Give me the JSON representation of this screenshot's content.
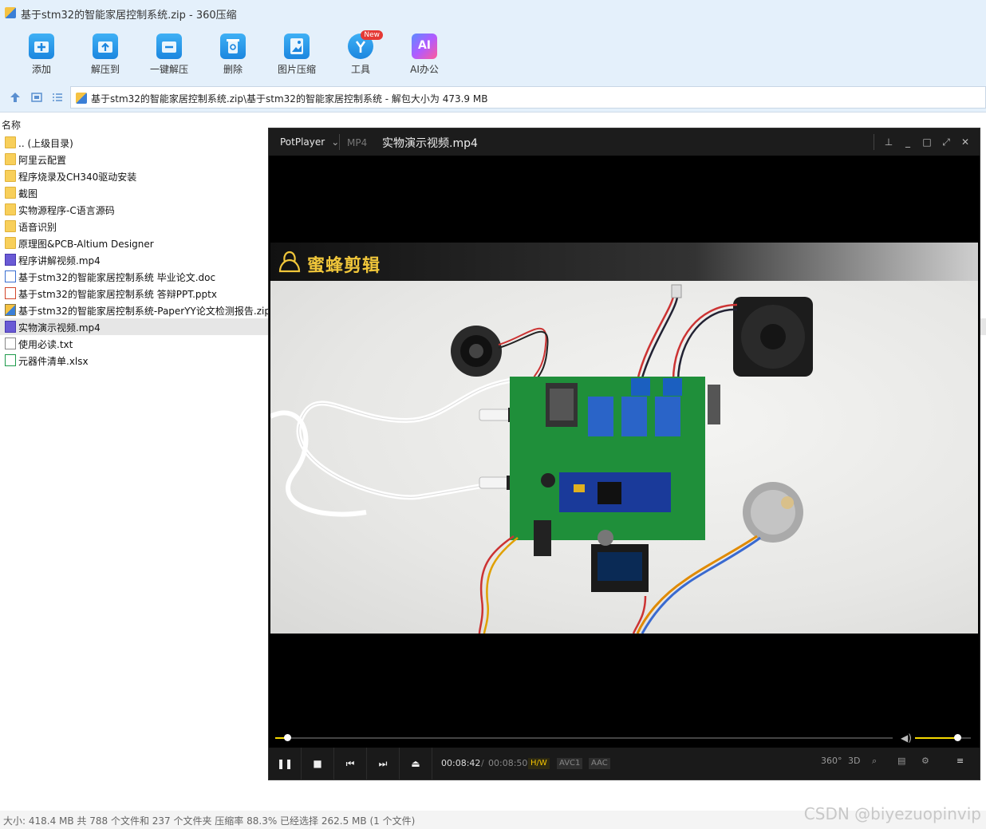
{
  "window": {
    "title": "基于stm32的智能家居控制系统.zip - 360压缩"
  },
  "toolbar": {
    "items": [
      {
        "label": "添加",
        "icon": "add-icon"
      },
      {
        "label": "解压到",
        "icon": "extract-to-icon"
      },
      {
        "label": "一键解压",
        "icon": "one-click-extract-icon"
      },
      {
        "label": "删除",
        "icon": "delete-icon"
      },
      {
        "label": "图片压缩",
        "icon": "image-compress-icon"
      },
      {
        "label": "工具",
        "icon": "tools-icon",
        "badge": "New"
      },
      {
        "label": "AI办公",
        "icon": "ai-office-icon",
        "icon_text": "AI"
      }
    ]
  },
  "address": {
    "path": "基于stm32的智能家居控制系统.zip\\基于stm32的智能家居控制系统 - 解包大小为 473.9 MB"
  },
  "list": {
    "column_name": "名称",
    "files": [
      {
        "name": ".. (上级目录)",
        "type": "folder"
      },
      {
        "name": "阿里云配置",
        "type": "folder"
      },
      {
        "name": "程序烧录及CH340驱动安装",
        "type": "folder"
      },
      {
        "name": "截图",
        "type": "folder"
      },
      {
        "name": "实物源程序-C语言源码",
        "type": "folder"
      },
      {
        "name": "语音识别",
        "type": "folder"
      },
      {
        "name": "原理图&PCB-Altium Designer",
        "type": "folder"
      },
      {
        "name": "程序讲解视频.mp4",
        "type": "mp4"
      },
      {
        "name": "基于stm32的智能家居控制系统 毕业论文.doc",
        "type": "doc"
      },
      {
        "name": "基于stm32的智能家居控制系统 答辩PPT.pptx",
        "type": "ppt"
      },
      {
        "name": "基于stm32的智能家居控制系统-PaperYY论文检测报告.zip",
        "type": "zip"
      },
      {
        "name": "实物演示视频.mp4",
        "type": "mp4",
        "selected": true
      },
      {
        "name": "使用必读.txt",
        "type": "txt"
      },
      {
        "name": "元器件清单.xlsx",
        "type": "xls"
      }
    ]
  },
  "status": {
    "text": "大小: 418.4 MB 共 788 个文件和 237 个文件夹 压缩率 88.3% 已经选择 262.5 MB (1 个文件)"
  },
  "watermark": "CSDN @biyezuopinvip",
  "player": {
    "brand": "PotPlayer",
    "format": "MP4",
    "filename": "实物演示视频.mp4",
    "banner_text": "蜜蜂剪辑",
    "current_time": "00:08:42",
    "time_separator": "/",
    "total_time": "00:08:50",
    "progress_fraction": 0.02,
    "volume_fraction": 0.75,
    "tags": {
      "hw": "H/W",
      "video": "AVC1",
      "audio": "AAC"
    },
    "right_labels": {
      "360": "360°",
      "3d": "3D"
    },
    "accent": "#f5d800"
  }
}
